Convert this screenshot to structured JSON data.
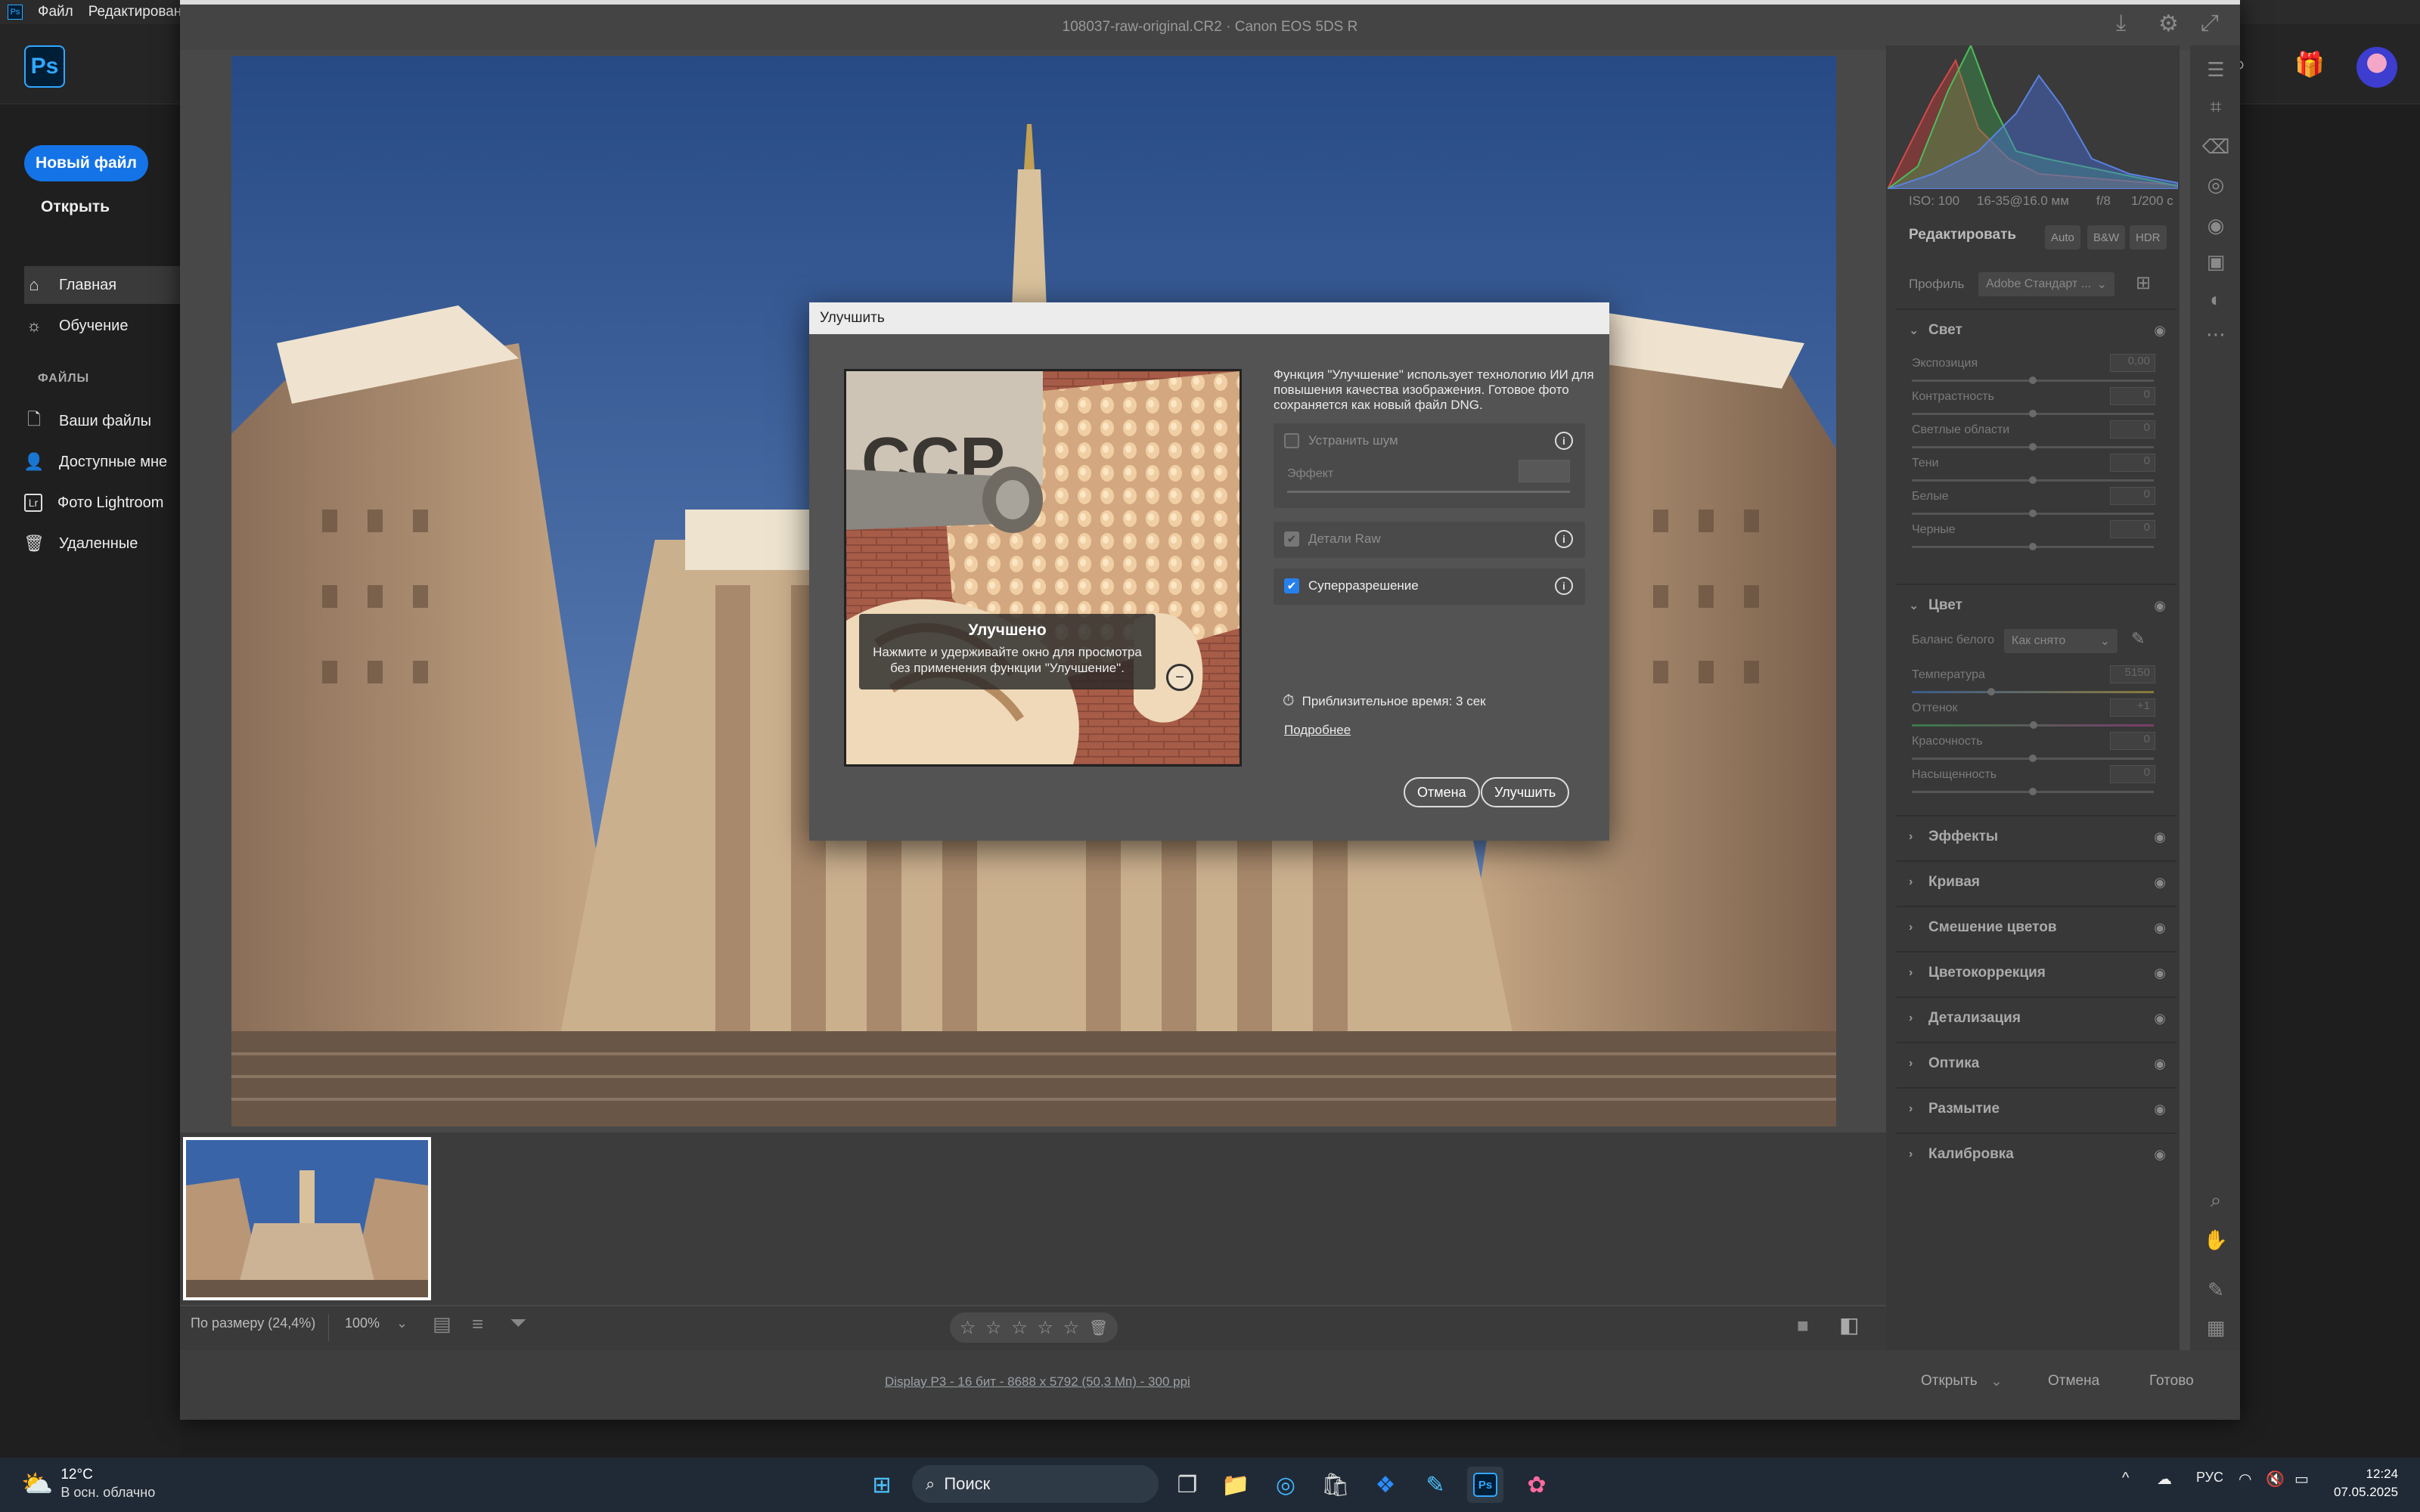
{
  "photoshop": {
    "menu": [
      "Файл",
      "Редактировани"
    ],
    "logo": "Ps",
    "new_file": "Новый файл",
    "open": "Открыть",
    "nav": [
      {
        "label": "Главная",
        "icon": "home-icon"
      },
      {
        "label": "Обучение",
        "icon": "lightbulb-icon"
      }
    ],
    "files_section": "ФАЙЛЫ",
    "files_nav": [
      {
        "label": "Ваши файлы",
        "icon": "file-icon"
      },
      {
        "label": "Доступные мне",
        "icon": "shared-users-icon"
      },
      {
        "label": "Фото Lightroom",
        "icon": "lightroom-icon"
      },
      {
        "label": "Удаленные",
        "icon": "trash-icon"
      }
    ]
  },
  "camera_raw": {
    "title": "108037-raw-original.CR2  ·  Canon EOS 5DS R",
    "meta": {
      "iso": "ISO: 100",
      "lens": "16-35@16.0 мм",
      "aperture": "f/8",
      "shutter": "1/200 с"
    },
    "edit_label": "Редактировать",
    "edit_pills": [
      "Auto",
      "B&W",
      "HDR"
    ],
    "profile_label": "Профиль",
    "profile_value": "Adobe Стандарт ...",
    "light_panel": {
      "title": "Свет",
      "sliders": [
        {
          "label": "Экспозиция",
          "value": "0,00"
        },
        {
          "label": "Контрастность",
          "value": "0"
        },
        {
          "label": "Светлые области",
          "value": "0"
        },
        {
          "label": "Тени",
          "value": "0"
        },
        {
          "label": "Белые",
          "value": "0"
        },
        {
          "label": "Черные",
          "value": "0"
        }
      ]
    },
    "color_panel": {
      "title": "Цвет",
      "wb_label": "Баланс белого",
      "wb_value": "Как снято",
      "sliders": [
        {
          "label": "Температура",
          "value": "5150"
        },
        {
          "label": "Оттенок",
          "value": "+1"
        },
        {
          "label": "Красочность",
          "value": "0"
        },
        {
          "label": "Насыщенность",
          "value": "0"
        }
      ]
    },
    "panels": [
      "Эффекты",
      "Кривая",
      "Смешение цветов",
      "Цветокоррекция",
      "Детализация",
      "Оптика",
      "Размытие",
      "Калибровка"
    ],
    "zoom_fit": "По размеру (24,4%)",
    "zoom_pct": "100%",
    "status_info": "Display P3 - 16 бит - 8688 x 5792 (50,3 Мп) - 300 ppi",
    "buttons": {
      "open": "Открыть",
      "cancel": "Отмена",
      "done": "Готово"
    }
  },
  "dialog": {
    "title": "Улучшить",
    "description": "Функция \"Улучшение\" использует технологию ИИ для повышения качества изображения. Готовое фото сохраняется как новый файл DNG.",
    "denoise": {
      "label": "Устранить шум",
      "checked": false
    },
    "effect_label": "Эффект",
    "raw_details": {
      "label": "Детали Raw",
      "checked": true
    },
    "super_res": {
      "label": "Суперразрешение",
      "checked": true
    },
    "preview_caption_title": "Улучшено",
    "preview_caption_text": "Нажмите и удерживайте окно для просмотра без применения функции \"Улучшение\".",
    "time_estimate": "Приблизительное время: 3 сек",
    "learn_more": "Подробнее",
    "cancel": "Отмена",
    "enhance": "Улучшить"
  },
  "taskbar": {
    "temperature": "12°C",
    "weather": "В осн. облачно",
    "search": "Поиск",
    "language": "РУС",
    "time": "12:24",
    "date": "07.05.2025"
  },
  "colors": {
    "accent": "#1473e6",
    "checkbox": "#2680eb",
    "dialog_bg": "#535353"
  }
}
